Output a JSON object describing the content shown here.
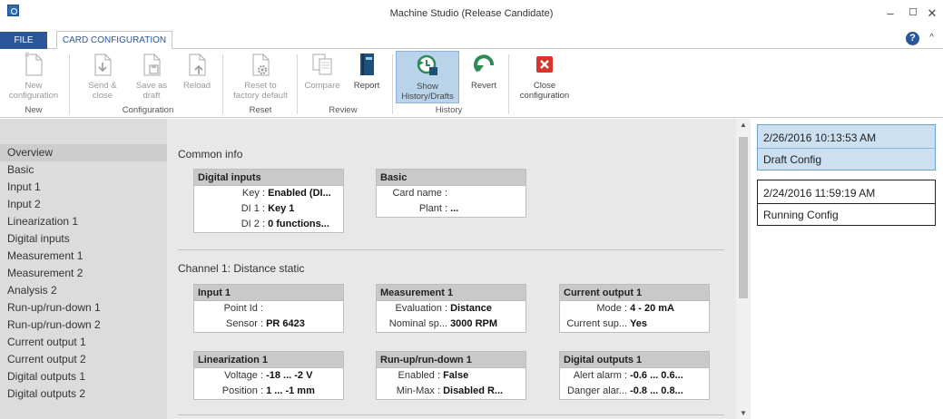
{
  "window": {
    "title": "Machine Studio (Release Candidate)",
    "minimize": "–",
    "maximize": "☐",
    "close": "✕"
  },
  "tabs": {
    "file": "FILE",
    "card": "CARD CONFIGURATION"
  },
  "help": "?",
  "collapse": "^",
  "ribbon": {
    "buttons": [
      {
        "label1": "New",
        "label2": "configuration"
      },
      {
        "label1": "Send &",
        "label2": "close"
      },
      {
        "label1": "Save as",
        "label2": "draft"
      },
      {
        "label1": "Reload",
        "label2": ""
      },
      {
        "label1": "Reset to",
        "label2": "factory default"
      },
      {
        "label1": "Compare",
        "label2": ""
      },
      {
        "label1": "Report",
        "label2": ""
      },
      {
        "label1": "Show",
        "label2": "History/Drafts"
      },
      {
        "label1": "Revert",
        "label2": ""
      },
      {
        "label1": "Close",
        "label2": "configuration"
      }
    ],
    "groups": [
      "New",
      "Configuration",
      "Reset",
      "Review",
      "History"
    ]
  },
  "sidebar": {
    "items": [
      "Overview",
      "Basic",
      "Input 1",
      "Input 2",
      "Linearization 1",
      "Digital inputs",
      "Measurement 1",
      "Measurement 2",
      "Analysis 2",
      "Run-up/run-down 1",
      "Run-up/run-down 2",
      "Current output 1",
      "Current output 2",
      "Digital outputs 1",
      "Digital outputs 2"
    ]
  },
  "content": {
    "common_title": "Common info",
    "channel_title": "Channel 1: Distance static",
    "cards": {
      "digital_inputs": {
        "title": "Digital inputs",
        "rows": [
          [
            "Key :",
            "Enabled (DI..."
          ],
          [
            "DI 1 :",
            "Key 1"
          ],
          [
            "DI 2 :",
            "0 functions..."
          ]
        ]
      },
      "basic": {
        "title": "Basic",
        "rows": [
          [
            "Card name :",
            ""
          ],
          [
            "Plant :",
            "..."
          ]
        ]
      },
      "input1": {
        "title": "Input 1",
        "rows": [
          [
            "Point Id :",
            ""
          ],
          [
            "Sensor :",
            "PR 6423"
          ]
        ]
      },
      "measurement1": {
        "title": "Measurement 1",
        "rows": [
          [
            "Evaluation :",
            "Distance"
          ],
          [
            "Nominal sp...",
            "3000  RPM"
          ]
        ]
      },
      "current_output1": {
        "title": "Current output 1",
        "rows": [
          [
            "Mode :",
            "4 - 20 mA"
          ],
          [
            "Current sup...",
            "Yes"
          ]
        ]
      },
      "linearization1": {
        "title": "Linearization 1",
        "rows": [
          [
            "Voltage :",
            "-18 ... -2 V"
          ],
          [
            "Position :",
            "1 ... -1 mm"
          ]
        ]
      },
      "runup1": {
        "title": "Run-up/run-down 1",
        "rows": [
          [
            "Enabled :",
            "False"
          ],
          [
            "Min-Max :",
            "Disabled  R..."
          ]
        ]
      },
      "digital_outputs1": {
        "title": "Digital outputs 1",
        "rows": [
          [
            "Alert alarm :",
            "-0.6 ... 0.6..."
          ],
          [
            "Danger alar...",
            "-0.8 ... 0.8..."
          ]
        ]
      }
    }
  },
  "history": [
    {
      "date": "2/26/2016 10:13:53 AM",
      "status": "Draft Config"
    },
    {
      "date": "2/24/2016 11:59:19 AM",
      "status": "Running Config"
    }
  ],
  "scroll": {
    "up": "▲",
    "down": "▼"
  }
}
